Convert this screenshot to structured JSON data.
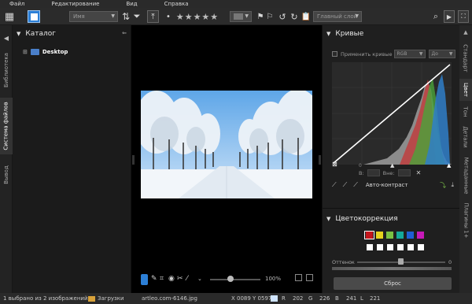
{
  "menu": [
    "Файл",
    "Редактирование",
    "Вид",
    "Справка"
  ],
  "toolbar": {
    "sort_select": "Имя",
    "layer_select": "Главный слой",
    "rating_dot": "•",
    "stars": "★★★★★"
  },
  "left_tabs": {
    "library": "Библиотека",
    "filesystem": "Система файлов",
    "output": "Вывод"
  },
  "catalog": {
    "title": "Каталог",
    "tree_item": "Desktop"
  },
  "viewer": {
    "zoom_text": "100%"
  },
  "curves": {
    "title": "Кривые",
    "apply_label": "Применить кривые",
    "channel": "RGB",
    "mode": "До",
    "in_label": "В:",
    "out_label": "Вне:",
    "in_value": "0",
    "auto_contrast": "Авто-контраст"
  },
  "color_correction": {
    "title": "Цветокоррекция",
    "hue_label": "Оттенок",
    "hue_value": "0",
    "swatches": [
      "#c4161c",
      "#e6d21d",
      "#7ac143",
      "#15a99a",
      "#1f5fd3",
      "#c619b8"
    ]
  },
  "reset_button": "Сброс",
  "right_tabs": {
    "standard": "Стандарт",
    "color": "Цвет",
    "tone": "Тон",
    "detail": "Детали",
    "metadata": "Метаданные",
    "plugins": "Плагины 1+"
  },
  "status": {
    "selection": "1 выбрано из 2 изображений",
    "folder": "Загрузки",
    "filename": "artleo.com-6146.jpg",
    "coords": "X 0089  Y 0597",
    "r_label": "R",
    "r_value": "202",
    "g_label": "G",
    "g_value": "226",
    "b_label": "B",
    "b_value": "241",
    "l_label": "L",
    "l_value": "221"
  },
  "colors": {
    "accent": "#4a7fc9",
    "sample_color": "#cfe4ff"
  }
}
